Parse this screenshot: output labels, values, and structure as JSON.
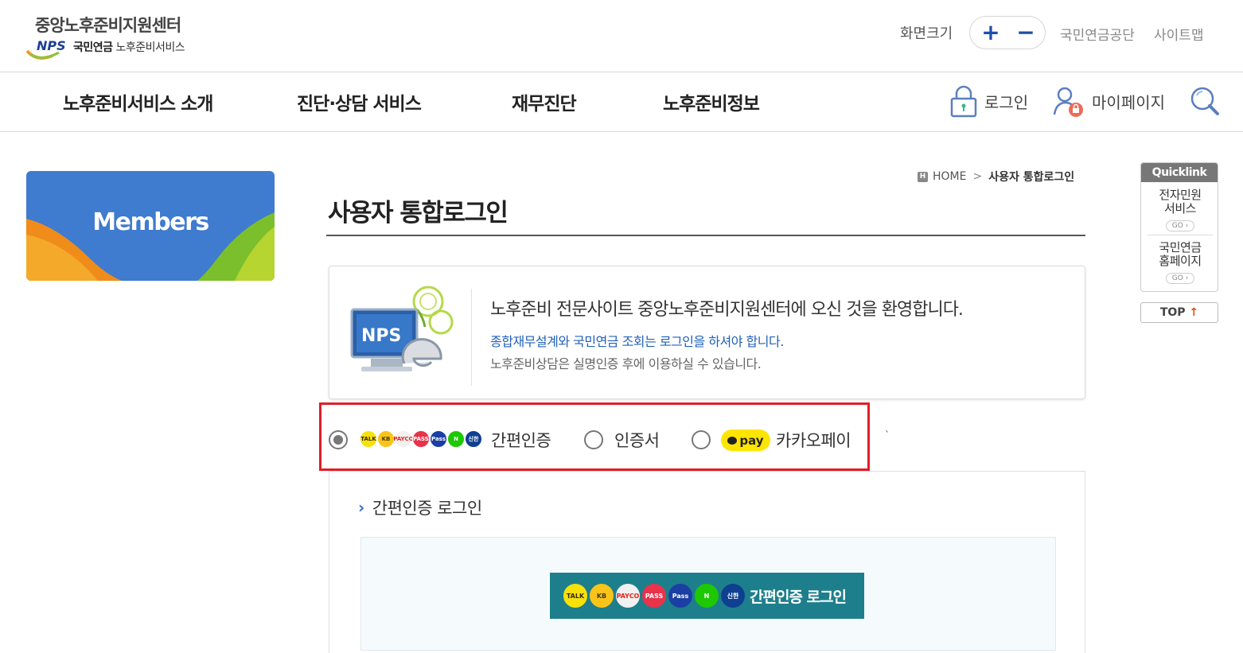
{
  "header": {
    "logo_title": "중앙노후준비지원센터",
    "logo_nps": "NPS",
    "logo_sub_bold": "국민연금",
    "logo_sub": "노후준비서비스",
    "font_size_label": "화면크기",
    "font_plus": "+",
    "font_minus": "−",
    "util_links": [
      "국민연금공단",
      "사이트맵"
    ]
  },
  "gnb": {
    "items": [
      "노후준비서비스 소개",
      "진단·상담 서비스",
      "재무진단",
      "노후준비정보"
    ],
    "login_label": "로그인",
    "mypage_label": "마이페이지"
  },
  "sidebar": {
    "banner_label": "Members"
  },
  "breadcrumb": {
    "home_icon": "H",
    "home": "HOME",
    "separator": ">",
    "current": "사용자 통합로그인"
  },
  "page_title": "사용자 통합로그인",
  "welcome": {
    "image_label": "NPS",
    "title": "노후준비 전문사이트 중앙노후준비지원센터에 오신 것을 환영합니다.",
    "line_blue": "종합재무설계와 국민연금 조회는 로그인을 하셔야 합니다.",
    "line_gray": "노후준비상담은 실명인증 후에 이용하실 수 있습니다."
  },
  "auth_options": {
    "simple_label": "간편인증",
    "cert_label": "인증서",
    "kakao_pay_badge": "pay",
    "kakao_label": "카카오페이",
    "selected": "간편인증",
    "stray_mark": "`",
    "provider_icons": [
      {
        "text": "TALK",
        "bg": "#f7e10a",
        "fg": "#3b2a1a"
      },
      {
        "text": "KB",
        "bg": "#f9c41a",
        "fg": "#4a3b10"
      },
      {
        "text": "PAYCO",
        "bg": "#f1f1f1",
        "fg": "#e0281b"
      },
      {
        "text": "PASS",
        "bg": "#e8334a",
        "fg": "#ffffff"
      },
      {
        "text": "Pass",
        "bg": "#1b3fa3",
        "fg": "#ffffff"
      },
      {
        "text": "N",
        "bg": "#1ec800",
        "fg": "#ffffff"
      },
      {
        "text": "신한",
        "bg": "#0f3f91",
        "fg": "#ffffff"
      }
    ]
  },
  "login_panel": {
    "heading": "간편인증 로그인",
    "chevron": "›",
    "button_label": "간편인증 로그인"
  },
  "quicklink": {
    "header": "Quicklink",
    "items": [
      {
        "label": "전자민원\n서비스",
        "go": "GO ›"
      },
      {
        "label": "국민연금\n홈페이지",
        "go": "GO ›"
      }
    ],
    "top_label": "TOP",
    "top_arrow": "↑"
  }
}
